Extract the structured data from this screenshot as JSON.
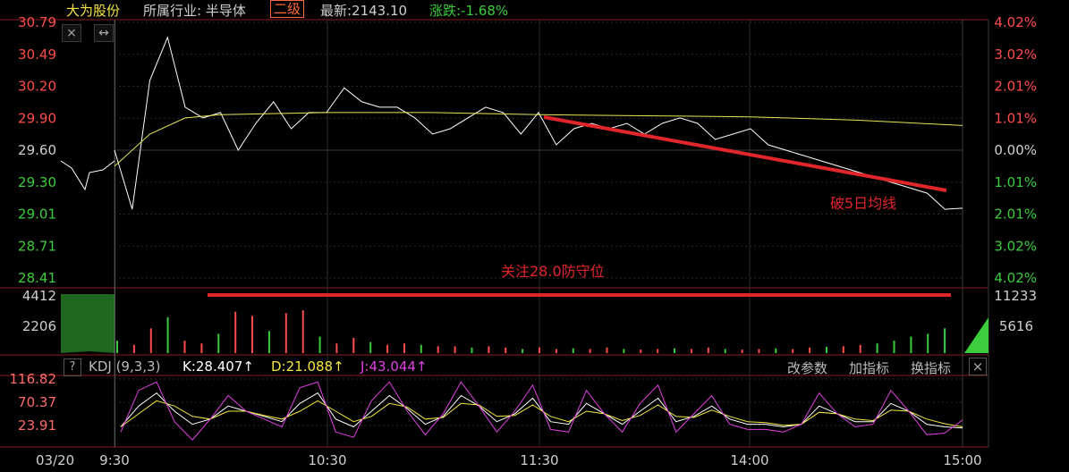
{
  "header": {
    "stock_name": "大为股份",
    "industry_label": "所属行业: 半导体",
    "level_badge": "二级",
    "latest": "最新:2143.10",
    "change": "涨跌:-1.68%"
  },
  "top_buttons": {
    "close": "×",
    "resize": "↔"
  },
  "price_axis": {
    "labels": [
      "30.79",
      "30.49",
      "30.20",
      "29.90",
      "29.60",
      "29.30",
      "29.01",
      "28.71",
      "28.41"
    ],
    "pct_labels": [
      "4.02%",
      "3.02%",
      "2.01%",
      "1.01%",
      "0.00%",
      "1.01%",
      "2.01%",
      "3.02%",
      "4.02%"
    ]
  },
  "volume_axis": {
    "left": [
      "4412",
      "2206"
    ],
    "right": [
      "11233",
      "5616"
    ]
  },
  "kdj": {
    "help": "?",
    "name": "KDJ (9,3,3)",
    "k": "K:28.407↑",
    "d": "D:21.088↑",
    "j": "J:43.044↑",
    "axis": [
      "116.82",
      "70.37",
      "23.91"
    ],
    "buttons": [
      "改参数",
      "加指标",
      "换指标"
    ],
    "close": "×"
  },
  "time_axis": [
    "03/20",
    "9:30",
    "10:30",
    "11:30",
    "14:00",
    "15:00"
  ],
  "annotations": {
    "break_ma": "破5日均线",
    "watch_level": "关注28.0防守位"
  },
  "colors": {
    "up": "#ff4d4d",
    "down": "#3dcc3d",
    "price_line": "#ffffff",
    "avg_line": "#e6e65a",
    "annotation": "#e0262b",
    "k_line": "#ffffff",
    "d_line": "#f5e642",
    "j_line": "#e040e0",
    "header_name": "#f5e642",
    "grid": "#2a2a2a",
    "border": "#8a1a1a"
  },
  "chart_data": [
    {
      "type": "line",
      "series": [
        {
          "name": "price",
          "x": [
            "09:30",
            "09:35",
            "09:40",
            "09:45",
            "09:50",
            "09:55",
            "10:00",
            "10:05",
            "10:10",
            "10:15",
            "10:20",
            "10:25",
            "10:30",
            "10:35",
            "10:40",
            "10:45",
            "10:50",
            "10:55",
            "11:00",
            "11:05",
            "11:10",
            "11:15",
            "11:20",
            "11:25",
            "11:30",
            "13:05",
            "13:10",
            "13:15",
            "13:20",
            "13:25",
            "13:30",
            "13:35",
            "13:40",
            "13:45",
            "13:50",
            "13:55",
            "14:00",
            "14:05",
            "14:10",
            "14:15",
            "14:20",
            "14:25",
            "14:30",
            "14:35",
            "14:40",
            "14:45",
            "14:50",
            "14:55",
            "15:00"
          ],
          "values": [
            29.6,
            29.05,
            30.25,
            30.65,
            30.0,
            29.9,
            29.95,
            29.6,
            29.85,
            30.05,
            29.8,
            29.95,
            29.95,
            30.18,
            30.05,
            30.0,
            30.0,
            29.9,
            29.75,
            29.8,
            29.9,
            30.0,
            29.95,
            29.75,
            29.95,
            29.65,
            29.8,
            29.85,
            29.8,
            29.85,
            29.75,
            29.85,
            29.9,
            29.85,
            29.7,
            29.75,
            29.8,
            29.65,
            29.6,
            29.55,
            29.5,
            29.45,
            29.4,
            29.35,
            29.3,
            29.25,
            29.2,
            29.05,
            29.06
          ]
        },
        {
          "name": "avg",
          "x": [
            "09:30",
            "09:40",
            "09:50",
            "10:00",
            "10:30",
            "11:00",
            "11:30",
            "13:30",
            "14:00",
            "14:30",
            "15:00"
          ],
          "values": [
            29.45,
            29.75,
            29.9,
            29.93,
            29.95,
            29.95,
            29.93,
            29.92,
            29.91,
            29.88,
            29.83
          ]
        }
      ],
      "ylim": [
        28.41,
        30.79
      ]
    },
    {
      "type": "bar",
      "series": [
        {
          "name": "volume",
          "values": [
            900,
            600,
            1800,
            2600,
            900,
            700,
            1400,
            3000,
            2700,
            1600,
            2900,
            3100,
            1200,
            700,
            1100,
            800,
            600,
            700,
            600,
            500,
            500,
            400,
            500,
            400,
            300,
            400,
            300,
            350,
            300,
            400,
            300,
            250,
            300,
            350,
            300,
            400,
            300,
            250,
            300,
            350,
            300,
            400,
            450,
            500,
            600,
            700,
            900,
            1200,
            1400,
            1800
          ]
        }
      ],
      "ylim": [
        0,
        4412
      ]
    },
    {
      "type": "line",
      "series": [
        {
          "name": "K",
          "values": [
            30,
            70,
            95,
            60,
            35,
            45,
            70,
            60,
            50,
            40,
            75,
            95,
            45,
            30,
            60,
            90,
            65,
            35,
            50,
            90,
            70,
            40,
            55,
            85,
            40,
            35,
            75,
            55,
            35,
            60,
            85,
            40,
            50,
            70,
            45,
            35,
            35,
            30,
            35,
            70,
            55,
            40,
            40,
            75,
            60,
            35,
            30,
            28
          ]
        },
        {
          "name": "D",
          "values": [
            30,
            55,
            80,
            70,
            50,
            45,
            60,
            60,
            52,
            45,
            60,
            80,
            60,
            40,
            50,
            75,
            68,
            45,
            48,
            75,
            72,
            50,
            52,
            72,
            50,
            40,
            60,
            55,
            42,
            52,
            72,
            50,
            48,
            62,
            50,
            40,
            38,
            33,
            35,
            58,
            55,
            45,
            42,
            62,
            60,
            45,
            36,
            30
          ]
        },
        {
          "name": "J",
          "values": [
            20,
            100,
            116,
            40,
            5,
            45,
            90,
            60,
            45,
            30,
            105,
            116,
            20,
            10,
            80,
            116,
            60,
            15,
            55,
            116,
            70,
            20,
            60,
            110,
            25,
            20,
            100,
            55,
            20,
            75,
            110,
            20,
            55,
            90,
            35,
            25,
            25,
            20,
            35,
            95,
            55,
            30,
            35,
            100,
            60,
            15,
            18,
            43
          ]
        }
      ],
      "ylim": [
        0,
        120
      ]
    }
  ]
}
